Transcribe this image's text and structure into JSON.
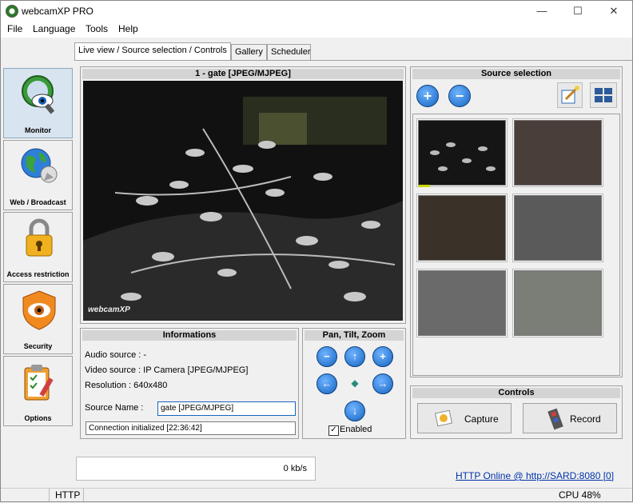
{
  "window": {
    "title": "webcamXP PRO",
    "minimize": "—",
    "maximize": "☐",
    "close": "✕"
  },
  "menu": [
    "File",
    "Language",
    "Tools",
    "Help"
  ],
  "sidebar": [
    {
      "label": "Monitor",
      "active": true
    },
    {
      "label": "Web / Broadcast",
      "active": false
    },
    {
      "label": "Access restriction",
      "active": false
    },
    {
      "label": "Security",
      "active": false
    },
    {
      "label": "Options",
      "active": false
    }
  ],
  "tabs": [
    "Live view / Source selection / Controls",
    "Gallery",
    "Scheduler"
  ],
  "live": {
    "title": "1 - gate [JPEG/MJPEG]",
    "watermark": "webcamXP"
  },
  "info": {
    "heading": "Informations",
    "audio": "Audio source : -",
    "video": "Video source : IP Camera [JPEG/MJPEG]",
    "resolution": "Resolution : 640x480",
    "source_name_label": "Source Name :",
    "source_name_value": "gate [JPEG/MJPEG]",
    "status": "Connection initialized [22:36:42]"
  },
  "ptz": {
    "heading": "Pan, Tilt, Zoom",
    "enabled_label": "Enabled",
    "enabled": true
  },
  "source_selection": {
    "heading": "Source selection"
  },
  "controls": {
    "heading": "Controls",
    "capture": "Capture",
    "record": "Record"
  },
  "bandwidth": "0 kb/s",
  "http_link": "HTTP Online @ http://SARD:8080 [0]",
  "statusbar": {
    "protocol": "HTTP",
    "cpu": "CPU 48%"
  },
  "colors": {
    "accent_blue": "#1565c0",
    "link": "#0033aa",
    "panel_head": "#d4d4d4"
  }
}
